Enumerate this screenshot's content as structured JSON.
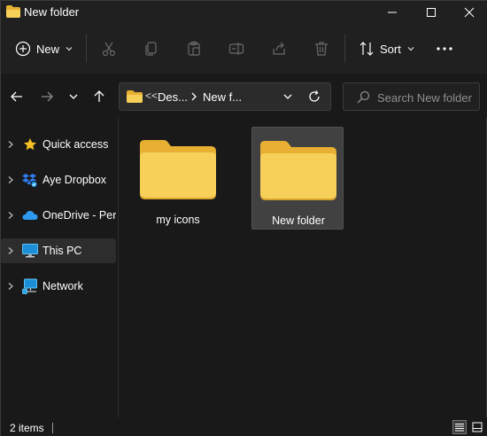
{
  "window": {
    "title": "New folder"
  },
  "commandbar": {
    "new_label": "New",
    "sort_label": "Sort",
    "icons": [
      "plus-icon",
      "cut-icon",
      "copy-icon",
      "paste-icon",
      "rename-icon",
      "share-icon",
      "delete-icon",
      "sort-icon",
      "more-icon"
    ]
  },
  "address": {
    "overflow": "<<",
    "segments": [
      "Des...",
      "New f..."
    ]
  },
  "search": {
    "placeholder": "Search New folder"
  },
  "sidebar": {
    "items": [
      {
        "label": "Quick access",
        "icon": "star-icon",
        "selected": false
      },
      {
        "label": "Aye Dropbox",
        "icon": "dropbox-icon",
        "selected": false
      },
      {
        "label": "OneDrive - Pers",
        "icon": "onedrive-icon",
        "selected": false
      },
      {
        "label": "This PC",
        "icon": "monitor-icon",
        "selected": true
      },
      {
        "label": "Network",
        "icon": "network-icon",
        "selected": false
      }
    ]
  },
  "content": {
    "items": [
      {
        "label": "my icons",
        "type": "folder",
        "selected": false
      },
      {
        "label": "New folder",
        "type": "folder",
        "selected": true
      }
    ]
  },
  "status": {
    "item_count": "2 items"
  },
  "colors": {
    "folder_front": "#f7d05a",
    "folder_back": "#e8b033",
    "background": "#191919",
    "bar": "#202020",
    "onedrive": "#2f9bf0",
    "star": "#f6c026"
  }
}
